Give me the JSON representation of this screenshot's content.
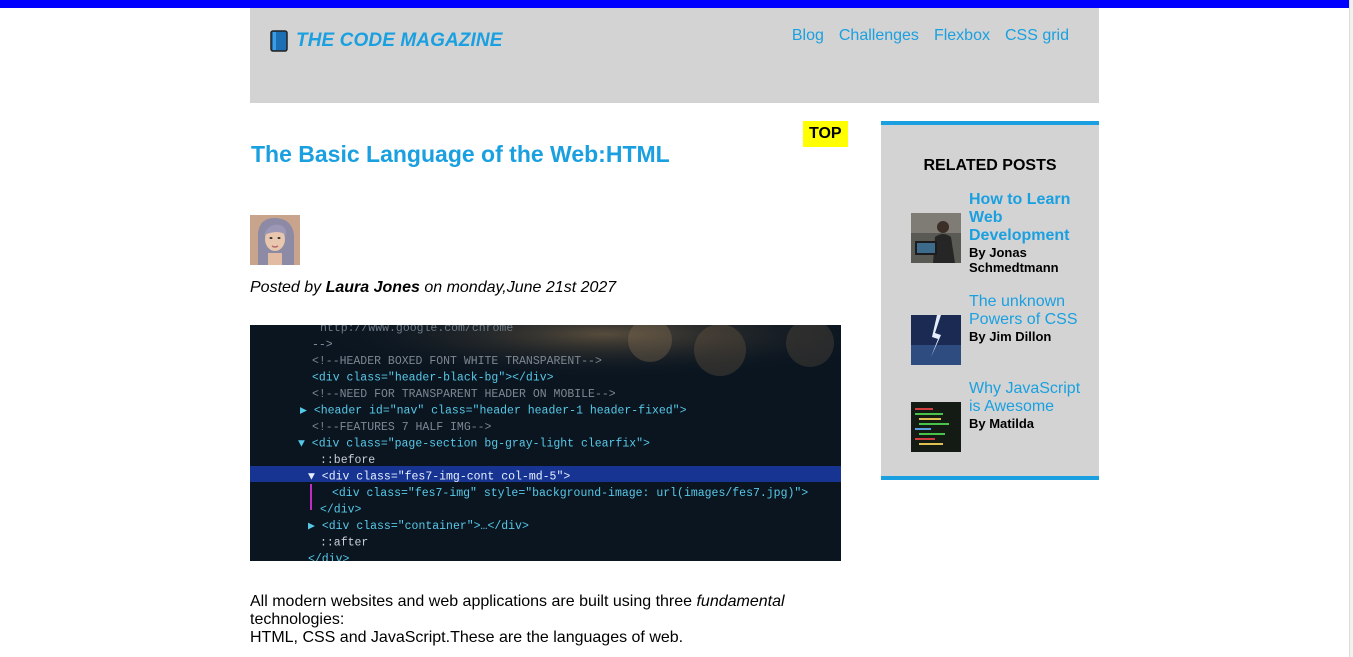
{
  "header": {
    "logo_text": "THE CODE MAGAZINE",
    "nav": [
      "Blog",
      "Challenges",
      "Flexbox",
      "CSS grid"
    ]
  },
  "post": {
    "badge": "TOP",
    "title": "The Basic Language of the Web:HTML",
    "posted_prefix": "Posted by",
    "author": "Laura Jones",
    "posted_suffix": "on monday,June 21st 2027",
    "intro": {
      "part1": "All modern websites and web applications are built using three",
      "emphasis": "fundamental",
      "part2": "technologies:",
      "line2": "HTML, CSS and JavaScript.These are the languages of web."
    }
  },
  "code_image": {
    "lines": [
      "  http://www.google.com/chrome",
      "-->",
      "<!--HEADER BOXED FONT WHITE TRANSPARENT-->",
      "<div class=\"header-black-bg\"></div>",
      "<!--NEED FOR TRANSPARENT HEADER ON MOBILE-->",
      "▶ <header id=\"nav\" class=\"header header-1 header-fixed\">",
      "<!--FEATURES 7 HALF IMG-->",
      "▼ <div class=\"page-section bg-gray-light clearfix\">",
      "  ::before",
      "▼ <div class=\"fes7-img-cont col-md-5\">",
      "    <div class=\"fes7-img\" style=\"background-image: url(images/fes7.jpg)\">",
      "  </div>",
      "▶ <div class=\"container\">…</div>",
      "  ::after",
      "</div>"
    ]
  },
  "sidebar": {
    "title": "RELATED POSTS",
    "posts": [
      {
        "title": "How to Learn Web Development",
        "author": "By Jonas Schmedtmann"
      },
      {
        "title": "The unknown Powers of CSS",
        "author": "By Jim Dillon"
      },
      {
        "title": "Why JavaScript is Awesome",
        "author": "By Matilda"
      }
    ]
  },
  "colors": {
    "accent": "#1aa0e0",
    "top_bar": "#0000ff",
    "panel": "#d3d3d3",
    "badge": "#ffff00"
  }
}
